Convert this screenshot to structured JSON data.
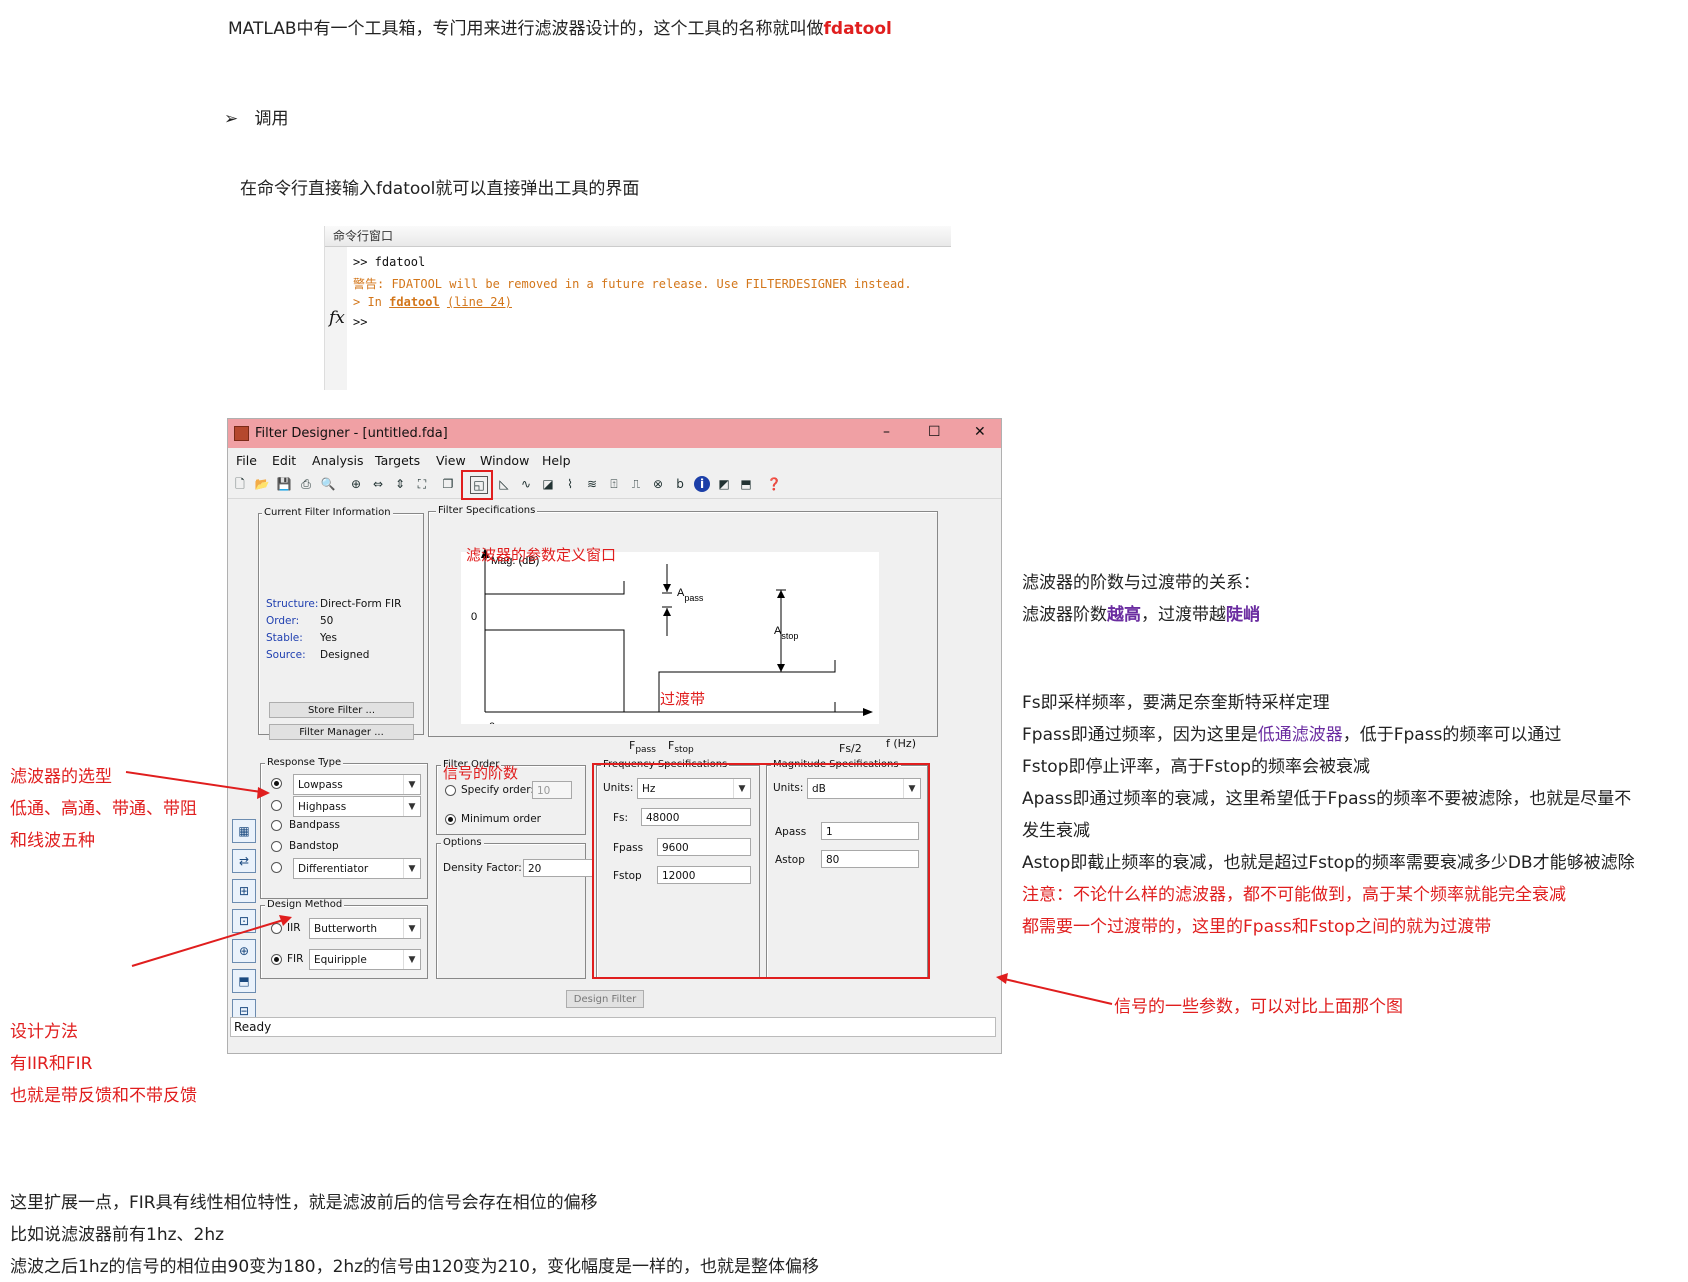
{
  "doc": {
    "line1_prefix": "MATLAB中有一个工具箱，专门用来进行滤波器设计的，这个工具的名称就叫做",
    "line1_tool": "fdatool",
    "bullet_marker": "➢",
    "bullet_text": "调用",
    "line2": "在命令行直接输入fdatool就可以直接弹出工具的界面",
    "bottom1": "这里扩展一点，FIR具有线性相位特性，就是滤波前后的信号会存在相位的偏移",
    "bottom2": "比如说滤波器前有1hz、2hz",
    "bottom3": "滤波之后1hz的信号的相位由90变为180，2hz的信号由120变为210，变化幅度是一样的，也就是整体偏移"
  },
  "command_window": {
    "title": "命令行窗口",
    "prompt1": ">> fdatool",
    "warning": "警告: FDATOOL will be removed in a future release. Use FILTERDESIGNER instead.",
    "in_prefix": "> In",
    "in_func": "fdatool",
    "in_line": "(line 24)",
    "fx": "fx",
    "prompt2": ">>"
  },
  "window": {
    "title": "Filter Designer - [untitled.fda]",
    "controls": {
      "minimize": "–",
      "maximize": "☐",
      "close": "✕"
    },
    "menu": [
      "File",
      "Edit",
      "Analysis",
      "Targets",
      "View",
      "Window",
      "Help"
    ],
    "current_info": {
      "label": "Current Filter Information",
      "rows": [
        {
          "key": "Structure:",
          "value": "Direct-Form FIR"
        },
        {
          "key": "Order:",
          "value": "50"
        },
        {
          "key": "Stable:",
          "value": "Yes"
        },
        {
          "key": "Source:",
          "value": "Designed"
        }
      ],
      "store_button": "Store Filter ...",
      "manager_button": "Filter Manager ..."
    },
    "filter_specs": {
      "label": "Filter Specifications",
      "plot": {
        "ylabel": "Mag. (dB)",
        "zero_y": "0",
        "zero_x": "0",
        "fpass": "F",
        "fpass_sub": "pass",
        "fstop": "F",
        "fstop_sub": "stop",
        "fs2": "Fs/2",
        "fhz": "f (Hz)",
        "apass": "A",
        "apass_sub": "pass",
        "astop": "A",
        "astop_sub": "stop"
      }
    },
    "response_type": {
      "label": "Response Type",
      "options": [
        {
          "label": "Lowpass",
          "selected": true
        },
        {
          "label": "Highpass",
          "selected": false
        },
        {
          "label": "Bandpass",
          "selected": false
        },
        {
          "label": "Bandstop",
          "selected": false
        },
        {
          "label": "Differentiator",
          "selected": false
        }
      ]
    },
    "design_method": {
      "label": "Design Method",
      "iir": "IIR",
      "iir_value": "Butterworth",
      "fir": "FIR",
      "fir_value": "Equiripple"
    },
    "filter_order": {
      "label": "Filter Order",
      "specify": "Specify order:",
      "specify_value": "10",
      "minimum": "Minimum order"
    },
    "options": {
      "label": "Options",
      "density": "Density Factor:",
      "density_value": "20"
    },
    "freq_specs": {
      "label": "Frequency Specifications",
      "units_label": "Units:",
      "units": "Hz",
      "fs_label": "Fs:",
      "fs": "48000",
      "fpass_label": "Fpass",
      "fpass": "9600",
      "fstop_label": "Fstop",
      "fstop": "12000"
    },
    "mag_specs": {
      "label": "Magnitude Specifications",
      "units_label": "Units:",
      "units": "dB",
      "apass_label": "Apass",
      "apass": "1",
      "astop_label": "Astop",
      "astop": "80"
    },
    "design_button": "Design Filter",
    "status": "Ready"
  },
  "annotations": {
    "param_window": "滤波器的参数定义窗口",
    "transition": "过渡带",
    "signal_order": "信号的阶数",
    "selection1": "滤波器的选型",
    "selection2": "低通、高通、带通、带阻",
    "selection3": "和线波五种",
    "design1": "设计方法",
    "design2": "有IIR和FIR",
    "design3": "也就是带反馈和不带反馈",
    "params": "信号的一些参数，可以对比上面那个图"
  },
  "right_notes": {
    "r1": "滤波器的阶数与过渡带的关系：",
    "r2_a": "滤波器阶数",
    "r2_b": "越高",
    "r2_c": "，过渡带越",
    "r2_d": "陡峭",
    "fs": "Fs即采样频率，要满足奈奎斯特采样定理",
    "fpass_a": "Fpass即通过频率，因为这里是",
    "fpass_b": "低通滤波器",
    "fpass_c": "，低于Fpass的频率可以通过",
    "fstop": "Fstop即停止评率，高于Fstop的频率会被衰减",
    "apass1": "Apass即通过频率的衰减，这里希望低于Fpass的频率不要被滤除，也就是尽量不",
    "apass2": "发生衰减",
    "astop": "Astop即截止频率的衰减，也就是超过Fstop的频率需要衰减多少DB才能够被滤除",
    "note1": "注意：不论什么样的滤波器，都不可能做到，高于某个频率就能完全衰减",
    "note2": "都需要一个过渡带的，这里的Fpass和Fstop之间的就为过渡带"
  },
  "colors": {
    "titlebar": "#f0a0a4",
    "annotation": "#e01e1e",
    "emphasis": "#6a2ca0"
  }
}
